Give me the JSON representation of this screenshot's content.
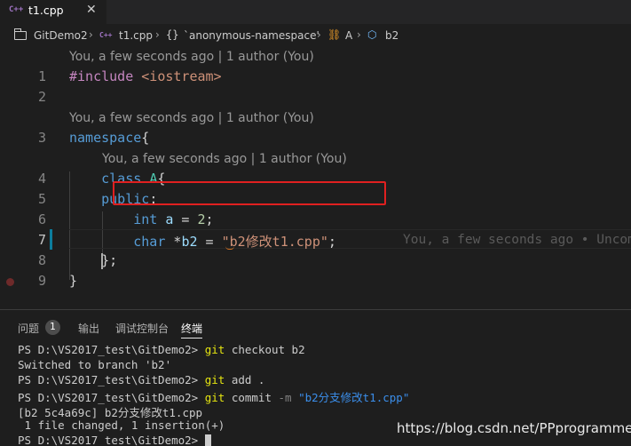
{
  "tab": {
    "icon": "C++",
    "label": "t1.cpp",
    "close": "✕"
  },
  "breadcrumb": {
    "folder": "GitDemo2",
    "file_icon": "C++",
    "file": "t1.cpp",
    "namespace_icon": "{}",
    "namespace": "`anonymous-namespace'",
    "class_icon": "⛓",
    "class": "A",
    "field_icon": "⬡",
    "field": "b2",
    "sep": "›"
  },
  "editor": {
    "codelens": "You, a few seconds ago | 1 author (You)",
    "lines": [
      {
        "n": "1",
        "p1": "#include ",
        "p2": "<iostream>"
      },
      {
        "n": "2"
      },
      {
        "n": "3",
        "kw": "namespace",
        "tail": "{"
      },
      {
        "n": "4",
        "pre": "    ",
        "kw": "class",
        "sp": " ",
        "cls": "A",
        "tail": "{"
      },
      {
        "n": "5",
        "pre": "    ",
        "kw": "public",
        "tail": ":"
      },
      {
        "n": "6",
        "pre": "        ",
        "kw": "int",
        "sp": " ",
        "var": "a",
        "op": " = ",
        "num": "2",
        "tail": ";"
      },
      {
        "n": "7",
        "pre": "        ",
        "kw": "char",
        "sp": " *",
        "var": "b2",
        "op": " = ",
        "str": "\"b2修改t1.cpp\"",
        "tail": ";"
      },
      {
        "n": "8",
        "pre": "    ",
        "tail": "};"
      },
      {
        "n": "9",
        "tail": "}"
      }
    ],
    "inline_blame": "You, a few seconds ago • Uncommitted changes"
  },
  "panel": {
    "tabs": [
      "问题",
      "输出",
      "调试控制台",
      "终端"
    ],
    "problems_count": "1",
    "terminal": {
      "prompt": "PS D:\\VS2017_test\\GitDemo2> ",
      "l1_cmd": "git",
      "l1_rest": " checkout b2",
      "l2": "Switched to branch 'b2'",
      "l3_cmd": "git",
      "l3_rest": " add .",
      "l4_cmd": "git",
      "l4_rest": " commit ",
      "l4_opt": "-m",
      "l4_str": " \"b2分支修改t1.cpp\"",
      "l5": "[b2 5c4a69c] b2分支修改t1.cpp",
      "l6": " 1 file changed, 1 insertion(+)"
    }
  },
  "watermark": "https://blog.csdn.net/PPprogrammer",
  "colors": {
    "background": "#1e1e1e",
    "keyword": "#569cd6",
    "string": "#ce9178",
    "highlight_box": "#e02020",
    "terminal_command": "#e5e510"
  }
}
